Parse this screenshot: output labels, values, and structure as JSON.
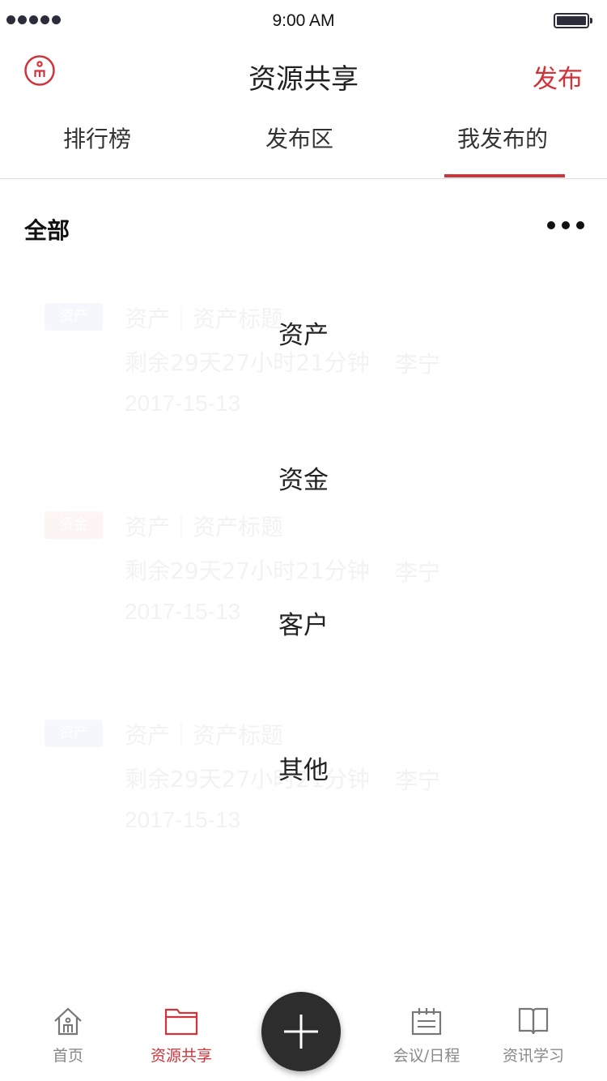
{
  "status_bar": {
    "time": "9:00 AM"
  },
  "nav": {
    "title": "资源共享",
    "publish_label": "发布"
  },
  "tabs": [
    {
      "label": "排行榜",
      "active": false
    },
    {
      "label": "发布区",
      "active": false
    },
    {
      "label": "我发布的",
      "active": true
    }
  ],
  "filter": {
    "current": "全部"
  },
  "dropdown_options": [
    "资产",
    "资金",
    "客户",
    "其他"
  ],
  "list": [
    {
      "tag": "资产",
      "tag_color": "#6b86d8",
      "title": "资产｜资产标题",
      "remaining": "剩余29天27小时21分钟",
      "person": "李宁",
      "date": "2017-15-13"
    },
    {
      "tag": "资金",
      "tag_color": "#e0604f",
      "title": "资产｜资产标题",
      "remaining": "剩余29天27小时21分钟",
      "person": "李宁",
      "date": "2017-15-13"
    },
    {
      "tag": "资产",
      "tag_color": "#6b86d8",
      "title": "资产｜资产标题",
      "remaining": "剩余29天27小时21分钟",
      "person": "李宁",
      "date": "2017-15-13"
    }
  ],
  "tabbar": {
    "home": "首页",
    "share": "资源共享",
    "meeting": "会议/日程",
    "news": "资讯学习"
  },
  "colors": {
    "accent": "#d0333a",
    "fab": "#2d2d2d",
    "inactive": "#888888"
  }
}
